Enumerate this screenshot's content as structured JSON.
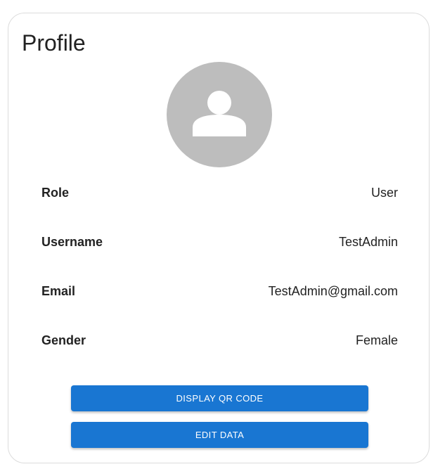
{
  "card": {
    "title": "Profile"
  },
  "avatar": {
    "icon": "account-person-icon",
    "background_color": "#bdbdbd",
    "icon_color": "#ffffff"
  },
  "fields": [
    {
      "label": "Role",
      "value": "User"
    },
    {
      "label": "Username",
      "value": "TestAdmin"
    },
    {
      "label": "Email",
      "value": "TestAdmin@gmail.com"
    },
    {
      "label": "Gender",
      "value": "Female"
    }
  ],
  "buttons": {
    "display_qr_label": "DISPLAY QR CODE",
    "edit_data_label": "EDIT DATA"
  },
  "colors": {
    "primary": "#1976d2",
    "text": "#222222",
    "card_border": "#dcdcdc"
  }
}
